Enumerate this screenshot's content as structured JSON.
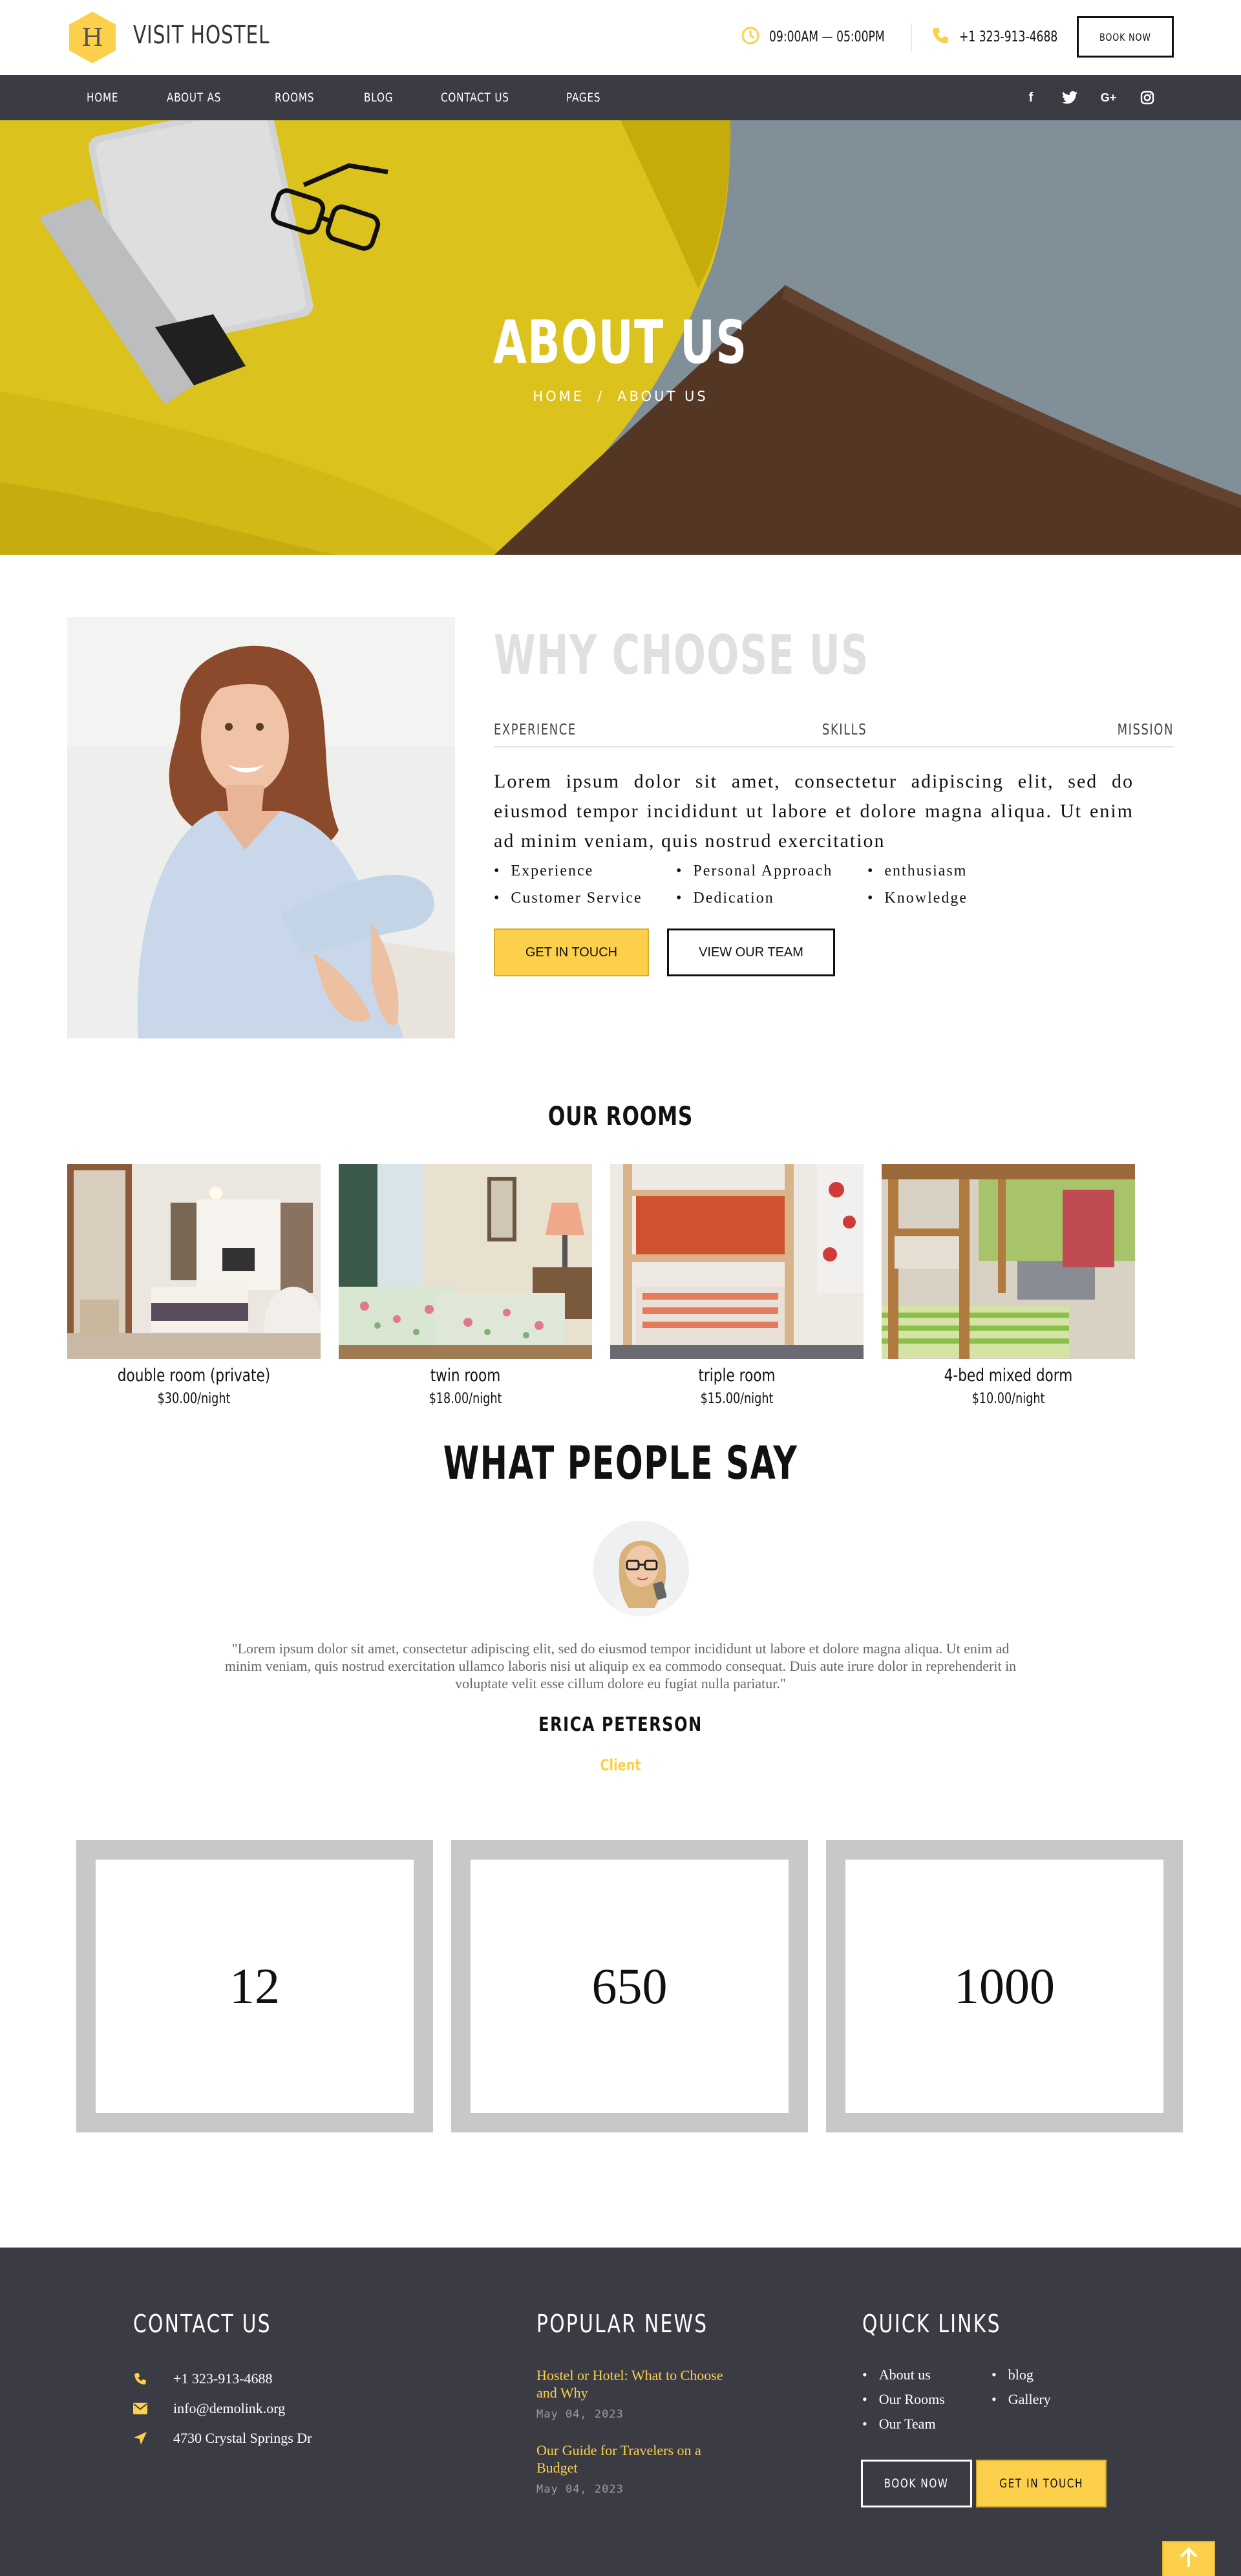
{
  "brand": {
    "name": "VISIT HOSTEL",
    "logo_letter": "H"
  },
  "topbar": {
    "hours": "09:00AM — 05:00PM",
    "phone": "+1 323-913-4688",
    "book_now": "BOOK NOW"
  },
  "nav": {
    "items": [
      {
        "label": "HOME"
      },
      {
        "label": "ABOUT AS"
      },
      {
        "label": "ROOMS"
      },
      {
        "label": "BLOG"
      },
      {
        "label": "CONTACT US"
      },
      {
        "label": "PAGES"
      }
    ],
    "socials": [
      "facebook-icon",
      "twitter-icon",
      "google-plus-icon",
      "instagram-icon"
    ],
    "social_glyphs": {
      "facebook": "f",
      "google": "G+"
    }
  },
  "hero": {
    "title": "ABOUT US",
    "crumb_home": "HOME",
    "crumb_sep": "/",
    "crumb_current": "ABOUT US"
  },
  "why": {
    "title": "WHY CHOOSE US",
    "tabs": [
      "EXPERIENCE",
      "SKILLS",
      "MISSION"
    ],
    "paragraph": "Lorem ipsum dolor sit amet, consectetur adipiscing elit, sed do eiusmod tempor incididunt ut labore et dolore magna aliqua. Ut enim ad minim veniam, quis nostrud exercitation",
    "features": [
      "Experience",
      "Personal Approach",
      "enthusiasm",
      "Customer Service",
      "Dedication",
      "Knowledge"
    ],
    "btn_primary": "GET IN TOUCH",
    "btn_secondary": "VIEW OUR TEAM"
  },
  "rooms": {
    "title": "OUR ROOMS",
    "items": [
      {
        "name": "double room (private)",
        "price": "$30.00/night"
      },
      {
        "name": "twin room",
        "price": "$18.00/night"
      },
      {
        "name": "triple room",
        "price": "$15.00/night"
      },
      {
        "name": "4-bed mixed dorm",
        "price": "$10.00/night"
      }
    ]
  },
  "testimonial": {
    "title": "WHAT PEOPLE SAY",
    "quote": "\"Lorem ipsum dolor sit amet, consectetur adipiscing elit, sed do eiusmod tempor incididunt ut labore et dolore magna aliqua. Ut enim ad minim veniam, quis nostrud exercitation ullamco laboris nisi ut aliquip ex ea commodo consequat. Duis aute irure dolor in reprehenderit in voluptate velit esse cillum dolore eu fugiat nulla pariatur.\"",
    "name": "ERICA PETERSON",
    "role": "Client"
  },
  "counters": [
    "12",
    "650",
    "1000"
  ],
  "footer": {
    "contact": {
      "title": "CONTACT US",
      "phone": "+1 323-913-4688",
      "email": "info@demolink.org",
      "address": "4730 Crystal Springs Dr"
    },
    "news": {
      "title": "POPULAR NEWS",
      "items": [
        {
          "title": "Hostel or Hotel: What to Choose and Why",
          "date": "May 04, 2023"
        },
        {
          "title": "Our Guide for Travelers on a Budget",
          "date": "May 04, 2023"
        }
      ]
    },
    "links": {
      "title": "QUICK LINKS",
      "items": [
        "About us",
        "blog",
        "Our Rooms",
        "Gallery",
        "Our Team"
      ]
    },
    "book_now": "BOOK NOW",
    "get_in_touch": "GET IN TOUCH"
  },
  "colors": {
    "accent": "#fcd04b",
    "dark": "#3b3b44"
  }
}
